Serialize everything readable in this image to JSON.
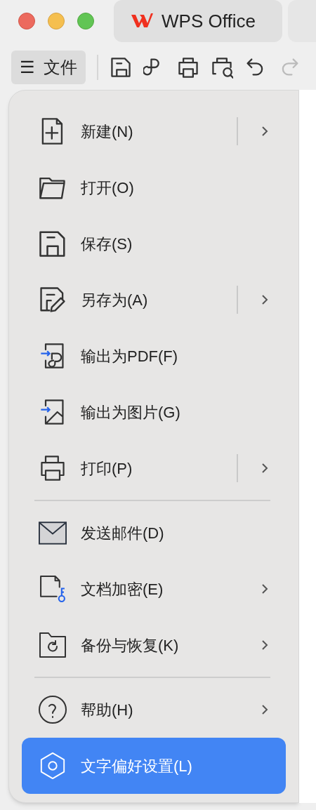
{
  "tabs": [
    {
      "label": "WPS Office",
      "selected": true
    },
    {
      "selected": false
    }
  ],
  "file_button": {
    "icon": "☰",
    "label": "文件"
  },
  "menu": {
    "groups": [
      [
        {
          "label": "新建(N)",
          "split": true,
          "submenu": true,
          "selected": false
        },
        {
          "label": "打开(O)",
          "split": false,
          "submenu": false,
          "selected": false
        },
        {
          "label": "保存(S)",
          "split": false,
          "submenu": false,
          "selected": false
        },
        {
          "label": "另存为(A)",
          "split": true,
          "submenu": true,
          "selected": false
        },
        {
          "label": "输出为PDF(F)",
          "split": false,
          "submenu": false,
          "selected": false
        },
        {
          "label": "输出为图片(G)",
          "split": false,
          "submenu": false,
          "selected": false
        },
        {
          "label": "打印(P)",
          "split": true,
          "submenu": true,
          "selected": false
        }
      ],
      [
        {
          "label": "发送邮件(D)",
          "split": false,
          "submenu": false,
          "selected": false
        },
        {
          "label": "文档加密(E)",
          "split": false,
          "submenu": true,
          "selected": false
        },
        {
          "label": "备份与恢复(K)",
          "split": false,
          "submenu": true,
          "selected": false
        }
      ],
      [
        {
          "label": "帮助(H)",
          "split": false,
          "submenu": true,
          "selected": false
        },
        {
          "label": "文字偏好设置(L)",
          "split": false,
          "submenu": false,
          "selected": true
        }
      ]
    ]
  }
}
